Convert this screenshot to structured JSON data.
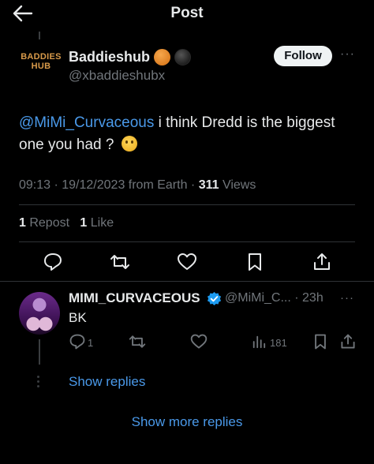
{
  "header": {
    "title": "Post"
  },
  "tweet": {
    "logo_line1": "BADDIES",
    "logo_line2": "HUB",
    "author_name": "Baddieshub",
    "author_handle": "@xbaddieshubx",
    "follow_label": "Follow",
    "more": "···",
    "mention": "@MiMi_Curvaceous",
    "text": " i think Dredd is the biggest one you had ? ",
    "emoji_icon": "thinking-face-icon",
    "time": "09:13 · 19/12/2023 from Earth · ",
    "views_count": "311",
    "views_label": " Views",
    "reposts_count": "1",
    "reposts_label": " Repost",
    "likes_count": "1",
    "likes_label": " Like"
  },
  "reply": {
    "name": "MIMI_CURVACEOUS",
    "handle_time": "@MiMi_C... · 23h",
    "more": "···",
    "text": "BK",
    "reply_count": "1",
    "views_count": "181"
  },
  "links": {
    "show_replies": "Show replies",
    "show_more_replies": "Show more replies"
  },
  "colors": {
    "accent": "#4a99e9",
    "muted": "#71767b",
    "text": "#e7e9ea",
    "background": "#000000"
  }
}
